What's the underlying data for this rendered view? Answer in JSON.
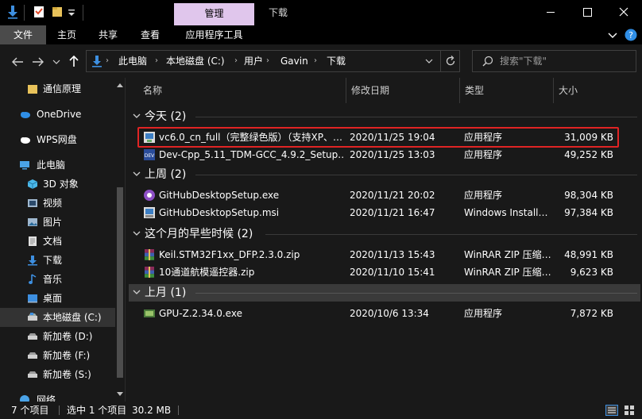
{
  "titlebar": {
    "context_tab": "管理",
    "window_title": "下载"
  },
  "ribbon": {
    "tabs": [
      "文件",
      "主页",
      "共享",
      "查看",
      "应用程序工具"
    ]
  },
  "address": {
    "crumbs": [
      "此电脑",
      "本地磁盘 (C:)",
      "用户",
      "Gavin",
      "下载"
    ]
  },
  "search": {
    "placeholder": "搜索\"下载\""
  },
  "sidebar": {
    "items": [
      {
        "label": "通信原理",
        "icon": "folder-icon",
        "color": "#e8c25a"
      },
      {
        "label": "OneDrive",
        "icon": "cloud-icon",
        "color": "#2f8ee6"
      },
      {
        "label": "WPS网盘",
        "icon": "cloud-icon",
        "color": "#ffffff"
      },
      {
        "label": "此电脑",
        "icon": "computer-icon",
        "color": "#4aa3e8"
      },
      {
        "label": "3D 对象",
        "icon": "cube-icon",
        "color": "#4bb8e8"
      },
      {
        "label": "视频",
        "icon": "video-icon",
        "color": "#9fb8d0"
      },
      {
        "label": "图片",
        "icon": "picture-icon",
        "color": "#9fb8d0"
      },
      {
        "label": "文档",
        "icon": "document-icon",
        "color": "#d0d0d0"
      },
      {
        "label": "下载",
        "icon": "download-icon",
        "color": "#3d8fe0"
      },
      {
        "label": "音乐",
        "icon": "music-icon",
        "color": "#3d8fe0"
      },
      {
        "label": "桌面",
        "icon": "desktop-icon",
        "color": "#3d8fe0"
      },
      {
        "label": "本地磁盘 (C:)",
        "icon": "drive-icon",
        "color": "#cfcfcf"
      },
      {
        "label": "新加卷 (D:)",
        "icon": "drive-icon",
        "color": "#cfcfcf"
      },
      {
        "label": "新加卷 (F:)",
        "icon": "drive-icon",
        "color": "#cfcfcf"
      },
      {
        "label": "新加卷 (S:)",
        "icon": "drive-icon",
        "color": "#cfcfcf"
      },
      {
        "label": "网络",
        "icon": "network-icon",
        "color": "#4aa3e8"
      }
    ]
  },
  "columns": {
    "name": "名称",
    "date": "修改日期",
    "type": "类型",
    "size": "大小"
  },
  "groups": [
    {
      "title": "今天 (2)",
      "files": [
        {
          "name": "vc6.0_cn_full（完整绿色版）（支持XP、…",
          "date": "2020/11/25 19:04",
          "type": "应用程序",
          "size": "31,009 KB",
          "icon": "exe-icon"
        },
        {
          "name": "Dev-Cpp_5.11_TDM-GCC_4.9.2_Setup.…",
          "date": "2020/11/25 13:03",
          "type": "应用程序",
          "size": "49,252 KB",
          "icon": "devcpp-icon"
        }
      ]
    },
    {
      "title": "上周 (2)",
      "files": [
        {
          "name": "GitHubDesktopSetup.exe",
          "date": "2020/11/21 20:02",
          "type": "应用程序",
          "size": "98,304 KB",
          "icon": "github-icon"
        },
        {
          "name": "GitHubDesktopSetup.msi",
          "date": "2020/11/21 16:47",
          "type": "Windows Install…",
          "size": "97,384 KB",
          "icon": "msi-icon"
        }
      ]
    },
    {
      "title": "这个月的早些时候 (2)",
      "files": [
        {
          "name": "Keil.STM32F1xx_DFP.2.3.0.zip",
          "date": "2020/11/13 15:43",
          "type": "WinRAR ZIP 压缩…",
          "size": "48,991 KB",
          "icon": "winrar-icon"
        },
        {
          "name": "10通道航模遥控器.zip",
          "date": "2020/11/10 15:41",
          "type": "WinRAR ZIP 压缩…",
          "size": "9,623 KB",
          "icon": "winrar-icon"
        }
      ]
    },
    {
      "title": "上月 (1)",
      "files": [
        {
          "name": "GPU-Z.2.34.0.exe",
          "date": "2020/10/6 13:34",
          "type": "应用程序",
          "size": "7,872 KB",
          "icon": "gpuz-icon"
        }
      ]
    }
  ],
  "status": {
    "count": "7 个项目",
    "selected": "选中 1 个项目",
    "size": "30.2 MB"
  }
}
